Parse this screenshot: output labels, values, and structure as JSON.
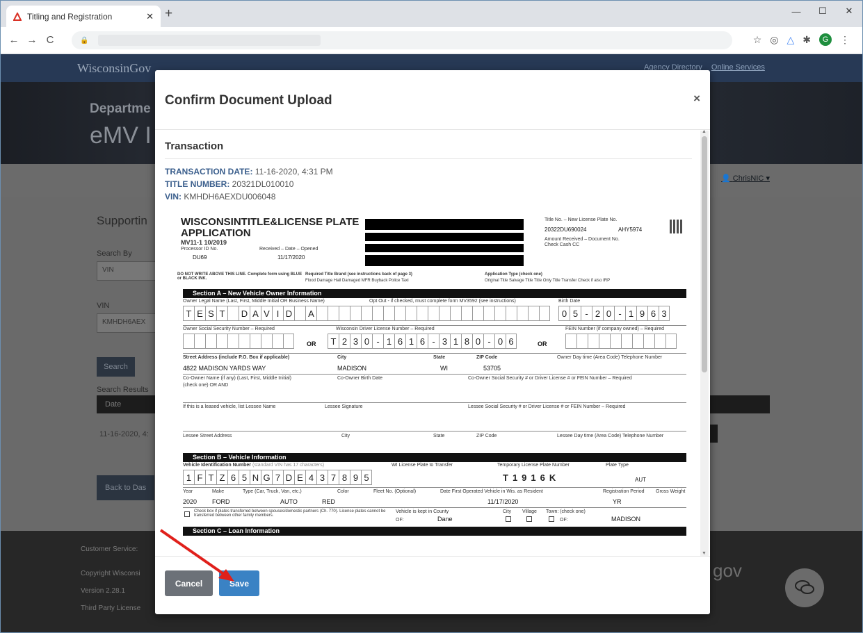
{
  "browser": {
    "tab_title": "Titling and Registration",
    "new_tab": "+",
    "nav": {
      "back": "←",
      "forward": "→",
      "reload": "C"
    },
    "profile_initial": "G"
  },
  "site": {
    "logo": "WisconsinGov",
    "links": [
      "Agency Directory",
      "Online Services"
    ],
    "dept": "Departme",
    "app": "eMV I",
    "user": "ChrisNIC"
  },
  "bg": {
    "supporting": "Supportin",
    "search_by_label": "Search By",
    "search_by_value": "VIN",
    "vin_label": "VIN",
    "vin_value": "KMHDH6AEX",
    "search_btn": "Search",
    "results_label": "Search Results",
    "date_col": "Date",
    "row_date": "11-16-2020, 4:",
    "back_btn": "Back to Das",
    "footer": [
      "Customer Service:",
      "Copyright Wisconsi",
      "Version 2.28.1",
      "Third Party License"
    ],
    "gov": "gov"
  },
  "modal": {
    "title": "Confirm Document Upload",
    "close": "×",
    "section": "Transaction",
    "transaction_date_label": "TRANSACTION DATE:",
    "transaction_date": "11-16-2020, 4:31 PM",
    "title_number_label": "TITLE NUMBER:",
    "title_number": "20321DL010010",
    "vin_label": "VIN:",
    "vin": "KMHDH6AEXDU006048",
    "cancel": "Cancel",
    "save": "Save"
  },
  "doc": {
    "title": "WISCONSINTITLE&LICENSE PLATE APPLICATION",
    "form_id": "MV11-1   10/2019",
    "processor_label": "Processor ID No.",
    "processor": "DU69",
    "received_label": "Received – Date – Opened",
    "received": "11/17/2020",
    "title_no_label": "Title No.   –   New License Plate No.",
    "title_no": "20322DU690024",
    "plate_no": "AHY5974",
    "amount_label": "Amount Received – Document No.",
    "check_cash": "Check       Cash        CC",
    "do_not_write": "DO NOT WRITE ABOVE THIS LINE. Complete form using BLUE or BLACK INK.",
    "brand_label": "Required Title Brand (see instructions back of page 3)",
    "brand_opts": "Flood Damage  Hail Damaged  MFR Buyback  Police  Taxi",
    "app_type_label": "Application Type (check one)",
    "app_type_opts": "Original Title  Salvage Title  Title Only  Title Transfer  Check if also IRP",
    "secA": "Section A – New Vehicle Owner Information",
    "owner_label": "Owner Legal Name (Last, First, Middle Initial OR Business Name)",
    "opt_out": "Opt Out - if checked, must complete form MV3592 (see instructions)",
    "birth_label": "Birth Date",
    "owner_chars": [
      "T",
      "E",
      "S",
      "T",
      "",
      "D",
      "A",
      "V",
      "I",
      "D",
      "",
      "A",
      "",
      "",
      "",
      "",
      "",
      "",
      "",
      "",
      "",
      "",
      "",
      "",
      "",
      "",
      "",
      "",
      "",
      "",
      "",
      "",
      ""
    ],
    "birth_chars": [
      "0",
      "5",
      "-",
      "2",
      "0",
      "-",
      "1",
      "9",
      "6",
      "3"
    ],
    "ssn_label": "Owner Social Security Number – Required",
    "dl_label": "Wisconsin Driver License Number – Required",
    "fein_label": "FEIN Number (if company owned) – Required",
    "or1": "OR",
    "or2": "OR",
    "dl_chars": [
      "T",
      "2",
      "3",
      "0",
      "-",
      "1",
      "6",
      "1",
      "6",
      "-",
      "3",
      "1",
      "8",
      "0",
      "-",
      "0",
      "6"
    ],
    "street_label": "Street Address (include P.O. Box if applicable)",
    "city_label": "City",
    "state_label": "State",
    "zip_label": "ZIP Code",
    "phone_label": "Owner Day time (Area Code) Telephone Number",
    "street": "4822 MADISON YARDS WAY",
    "city": "MADISON",
    "state": "WI",
    "zip": "53705",
    "coowner_label": "Co-Owner Name (if any) (Last, First, Middle Initial)",
    "coowner_check": "(check one)  OR   AND",
    "coowner_birth": "Co-Owner Birth Date",
    "coowner_ssn": "Co-Owner Social Security # or Driver License # or FEIN Number – Required",
    "lessee_label": "If this is a leased vehicle, list Lessee Name",
    "lessee_sig": "Lessee Signature",
    "lessee_ssn": "Lessee Social Security # or Driver License # or FEIN Number – Required",
    "lessee_street": "Lessee Street Address",
    "lessee_city": "City",
    "lessee_state": "State",
    "lessee_zip": "ZIP Code",
    "lessee_phone": "Lessee Day time (Area Code) Telephone Number",
    "secB": "Section B – Vehicle Information",
    "vin_label": "Vehicle Identification Number",
    "vin_note": "(standard VIN has 17 characters)",
    "wi_plate_label": "WI License Plate to Transfer",
    "temp_plate_label": "Temporary License Plate Number",
    "plate_type_label": "Plate Type",
    "vin_chars": [
      "1",
      "F",
      "T",
      "Z",
      "6",
      "5",
      "N",
      "G",
      "7",
      "D",
      "E",
      "4",
      "3",
      "7",
      "8",
      "9",
      "5"
    ],
    "temp_plate": "T1916K",
    "plate_type": "AUT",
    "year_label": "Year",
    "make_label": "Make",
    "type_label": "Type (Car, Truck, Van, etc.)",
    "color_label": "Color",
    "fleet_label": "Fleet No. (Optional)",
    "first_op_label": "Date First Operated Vehicle in Wis. as Resident",
    "reg_label": "Registration Period",
    "gross_label": "Gross Weight",
    "year": "2020",
    "make": "FORD",
    "type": "AUTO",
    "color": "RED",
    "first_op": "11/17/2020",
    "reg": "YR",
    "transfer_note": "Check box if plates transferred between spouses/domestic partners (Ch. 770). License plates cannot be transferred between other family members.",
    "county_label": "Vehicle is kept in County",
    "county_of": "OF:",
    "county": "Dane",
    "city_opt": "City",
    "village_opt": "Village",
    "town_opt": "Town: (check one)",
    "town_of": "OF:",
    "town": "MADISON",
    "secC": "Section C – Loan Information"
  },
  "colors": {
    "header_blue": "#273955",
    "save_blue": "#3a82c4",
    "cancel_gray": "#6c7178",
    "arrow_red": "#e0201b"
  }
}
